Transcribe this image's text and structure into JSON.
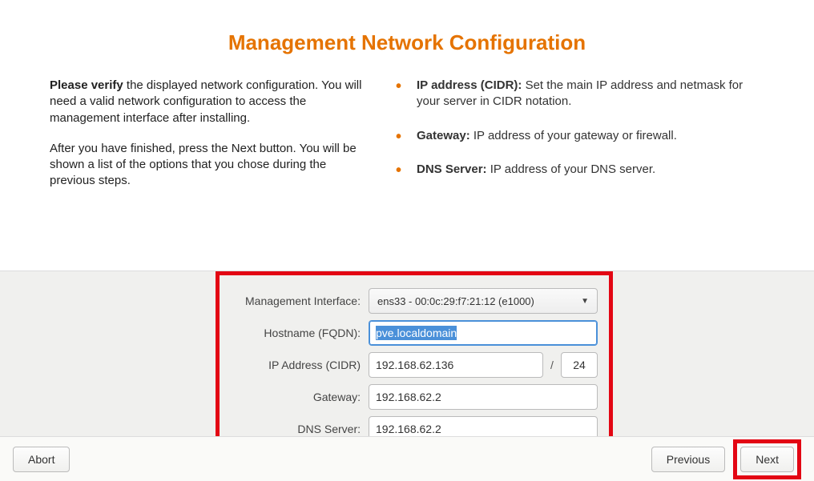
{
  "title": "Management Network Configuration",
  "left": {
    "p1_strong": "Please verify",
    "p1_rest": " the displayed network configuration. You will need a valid network configuration to access the management interface after installing.",
    "p2": "After you have finished, press the Next button. You will be shown a list of the options that you chose during the previous steps."
  },
  "bullets": {
    "b1_strong": "IP address (CIDR):",
    "b1_rest": " Set the main IP address and netmask for your server in CIDR notation.",
    "b2_strong": "Gateway:",
    "b2_rest": " IP address of your gateway or firewall.",
    "b3_strong": "DNS Server:",
    "b3_rest": " IP address of your DNS server."
  },
  "form": {
    "mgmt_iface_label": "Management Interface:",
    "mgmt_iface_value": "ens33 - 00:0c:29:f7:21:12 (e1000)",
    "hostname_label": "Hostname (FQDN):",
    "hostname_value": "pve.localdomain",
    "ip_label": "IP Address (CIDR)",
    "ip_value": "192.168.62.136",
    "cidr_slash": "/",
    "cidr_value": "24",
    "gateway_label": "Gateway:",
    "gateway_value": "192.168.62.2",
    "dns_label": "DNS Server:",
    "dns_value": "192.168.62.2"
  },
  "buttons": {
    "abort": "Abort",
    "previous": "Previous",
    "next": "Next"
  }
}
